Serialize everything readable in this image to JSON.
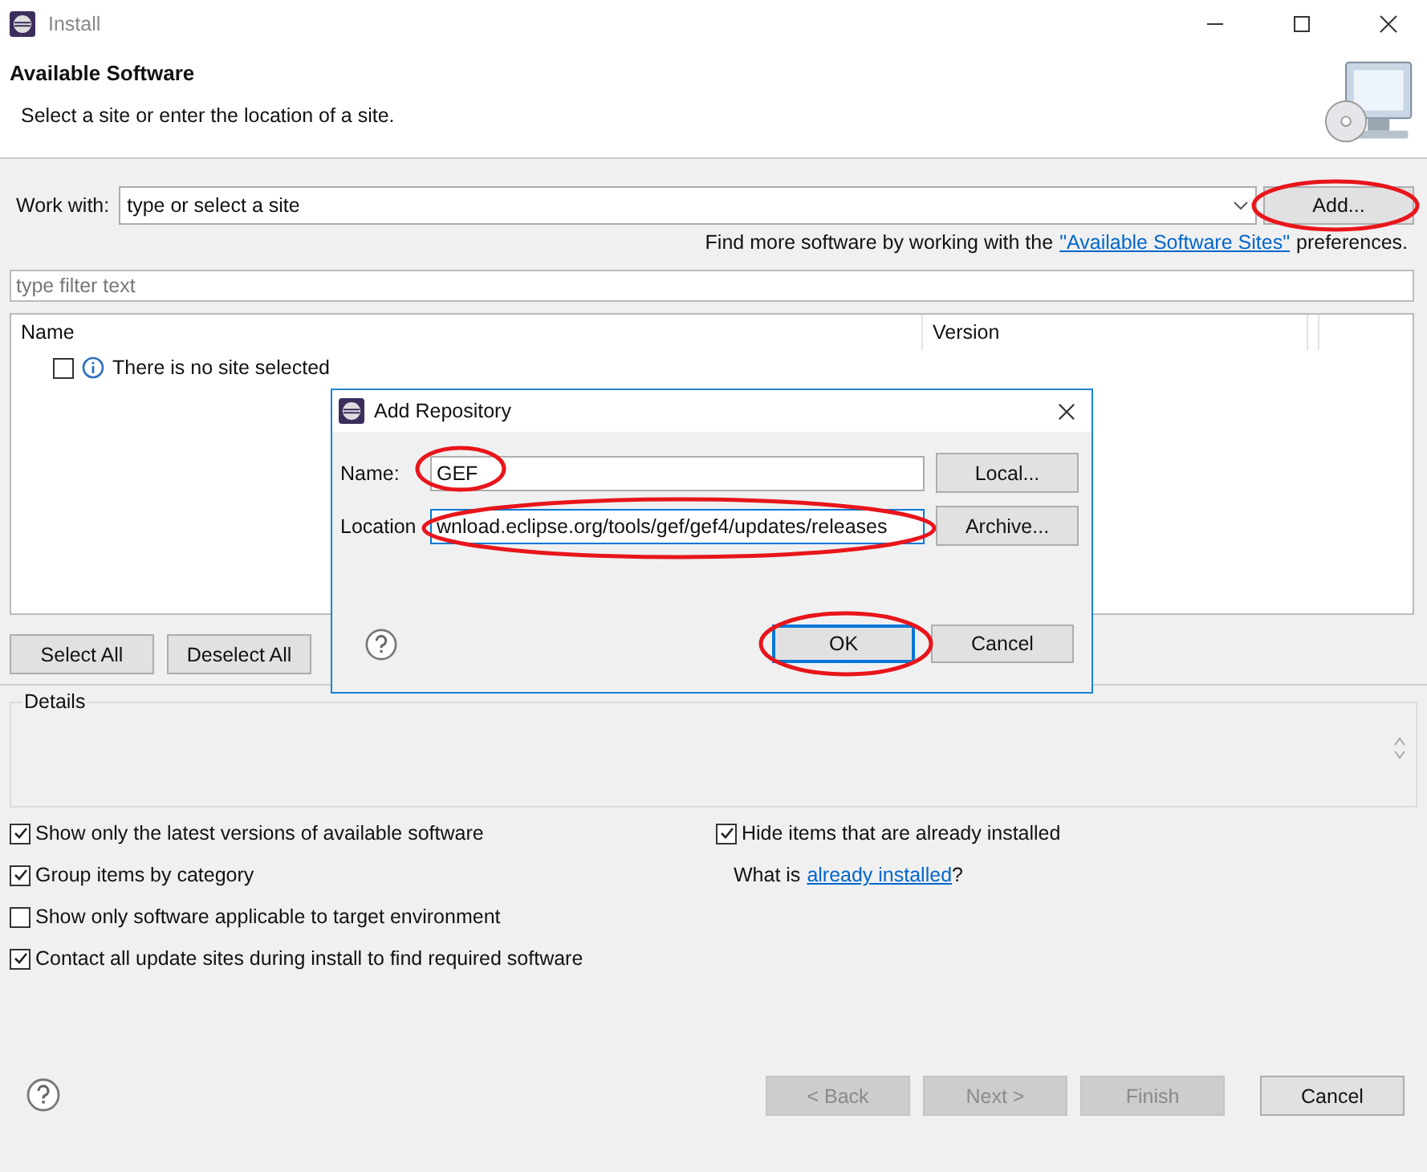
{
  "window": {
    "title": "Install"
  },
  "header": {
    "title": "Available Software",
    "subtitle": "Select a site or enter the location of a site."
  },
  "work_with": {
    "label": "Work with:",
    "value": "type or select a site",
    "button": "Add..."
  },
  "more_software": {
    "prefix": "Find more software by working with the",
    "link": "\"Available Software Sites\"",
    "suffix": "preferences."
  },
  "filter": {
    "placeholder": "type filter text"
  },
  "tree": {
    "columns": [
      "Name",
      "Version"
    ],
    "rows": [
      {
        "label": "There is no site selected",
        "checked": false
      }
    ]
  },
  "selection_buttons": [
    "Select All",
    "Deselect All"
  ],
  "details": {
    "title": "Details"
  },
  "options_left": [
    {
      "label": "Show only the latest versions of available software",
      "checked": true
    },
    {
      "label": "Group items by category",
      "checked": true
    },
    {
      "label": "Show only software applicable to target environment",
      "checked": false
    },
    {
      "label": "Contact all update sites during install to find required software",
      "checked": true
    }
  ],
  "options_right": [
    {
      "label": "Hide items that are already installed",
      "checked": true
    }
  ],
  "installed_note": {
    "prefix": "What is",
    "link": "already installed",
    "suffix": "?"
  },
  "footer_buttons": [
    {
      "label": "< Back",
      "disabled": true
    },
    {
      "label": "Next >",
      "disabled": true
    },
    {
      "label": "Finish",
      "disabled": true
    },
    {
      "label": "Cancel",
      "disabled": false
    }
  ],
  "dialog": {
    "title": "Add Repository",
    "fields": [
      {
        "label": "Name:",
        "value": "GEF",
        "button": "Local...",
        "focused": false
      },
      {
        "label": "Location",
        "value": "wnload.eclipse.org/tools/gef/gef4/updates/releases",
        "button": "Archive...",
        "focused": true
      }
    ],
    "buttons": [
      {
        "label": "OK",
        "default": true
      },
      {
        "label": "Cancel",
        "default": false
      }
    ]
  }
}
